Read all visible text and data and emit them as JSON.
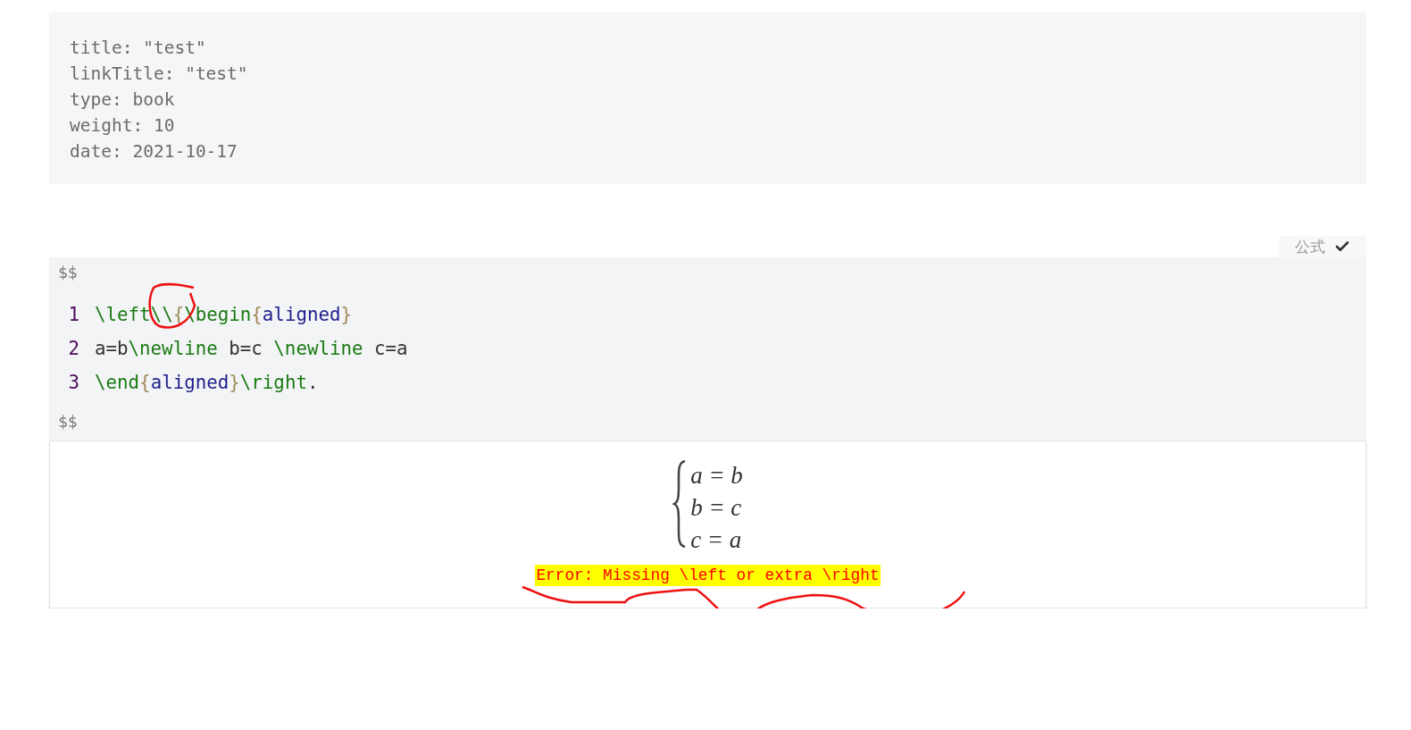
{
  "front_matter": {
    "lines": [
      "title: \"test\"",
      "linkTitle: \"test\"",
      "type: book",
      "weight: 10",
      "date: 2021-10-17"
    ]
  },
  "formula_block": {
    "label": "公式",
    "delimiter_open": "$$",
    "delimiter_close": "$$",
    "lines": [
      {
        "number": "1",
        "tokens": [
          {
            "kind": "command",
            "text": "\\left"
          },
          {
            "kind": "command",
            "text": "\\\\"
          },
          {
            "kind": "brace",
            "text": "{"
          },
          {
            "kind": "command",
            "text": "\\begin"
          },
          {
            "kind": "brace",
            "text": "{"
          },
          {
            "kind": "argument",
            "text": "aligned"
          },
          {
            "kind": "brace",
            "text": "}"
          }
        ]
      },
      {
        "number": "2",
        "tokens": [
          {
            "kind": "plain",
            "text": "a=b"
          },
          {
            "kind": "command",
            "text": "\\newline"
          },
          {
            "kind": "plain",
            "text": " b=c "
          },
          {
            "kind": "command",
            "text": "\\newline"
          },
          {
            "kind": "plain",
            "text": " c=a"
          }
        ]
      },
      {
        "number": "3",
        "tokens": [
          {
            "kind": "command",
            "text": "\\end"
          },
          {
            "kind": "brace",
            "text": "{"
          },
          {
            "kind": "argument",
            "text": "aligned"
          },
          {
            "kind": "brace",
            "text": "}"
          },
          {
            "kind": "command",
            "text": "\\right"
          },
          {
            "kind": "plain",
            "text": "."
          }
        ]
      }
    ],
    "preview": {
      "equations": [
        [
          "a",
          "=",
          "b"
        ],
        [
          "b",
          "=",
          "c"
        ],
        [
          "c",
          "=",
          "a"
        ]
      ],
      "error": "Error: Missing \\left or extra \\right"
    }
  }
}
